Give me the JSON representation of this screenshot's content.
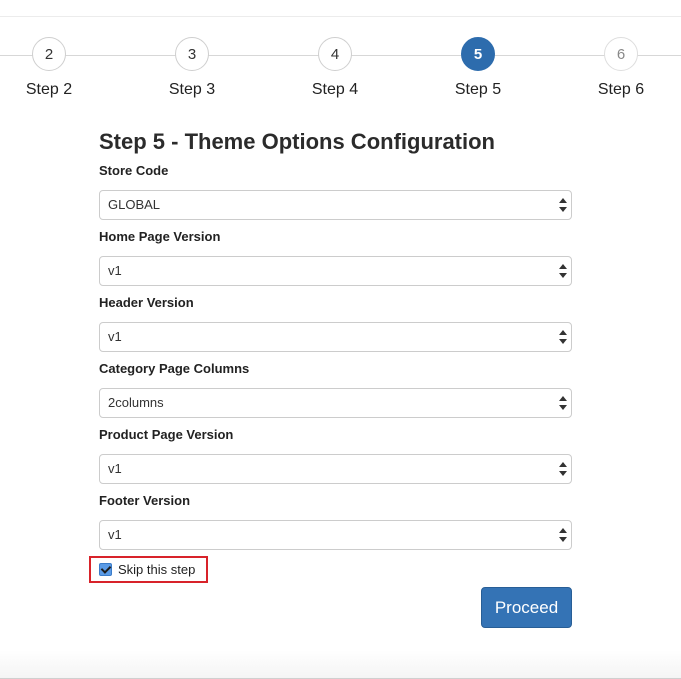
{
  "stepper": {
    "steps": [
      {
        "number": "2",
        "label": "Step 2"
      },
      {
        "number": "3",
        "label": "Step 3"
      },
      {
        "number": "4",
        "label": "Step 4"
      },
      {
        "number": "5",
        "label": "Step 5"
      },
      {
        "number": "6",
        "label": "Step 6"
      }
    ],
    "active_step": "5"
  },
  "form": {
    "title": "Step 5 - Theme Options Configuration",
    "fields": [
      {
        "label": "Store Code",
        "value": "GLOBAL"
      },
      {
        "label": "Home Page Version",
        "value": "v1"
      },
      {
        "label": "Header Version",
        "value": "v1"
      },
      {
        "label": "Category Page Columns",
        "value": "2columns"
      },
      {
        "label": "Product Page Version",
        "value": "v1"
      },
      {
        "label": "Footer Version",
        "value": "v1"
      }
    ],
    "skip_label": "Skip this step",
    "skip_checked": true,
    "proceed_label": "Proceed"
  },
  "colors": {
    "accent": "#2d6cad",
    "button": "#3473b5",
    "highlight_border": "#d8232a"
  },
  "icons": {
    "select_arrows": "select-arrows-icon",
    "checkbox": "checkbox-checked-icon"
  }
}
